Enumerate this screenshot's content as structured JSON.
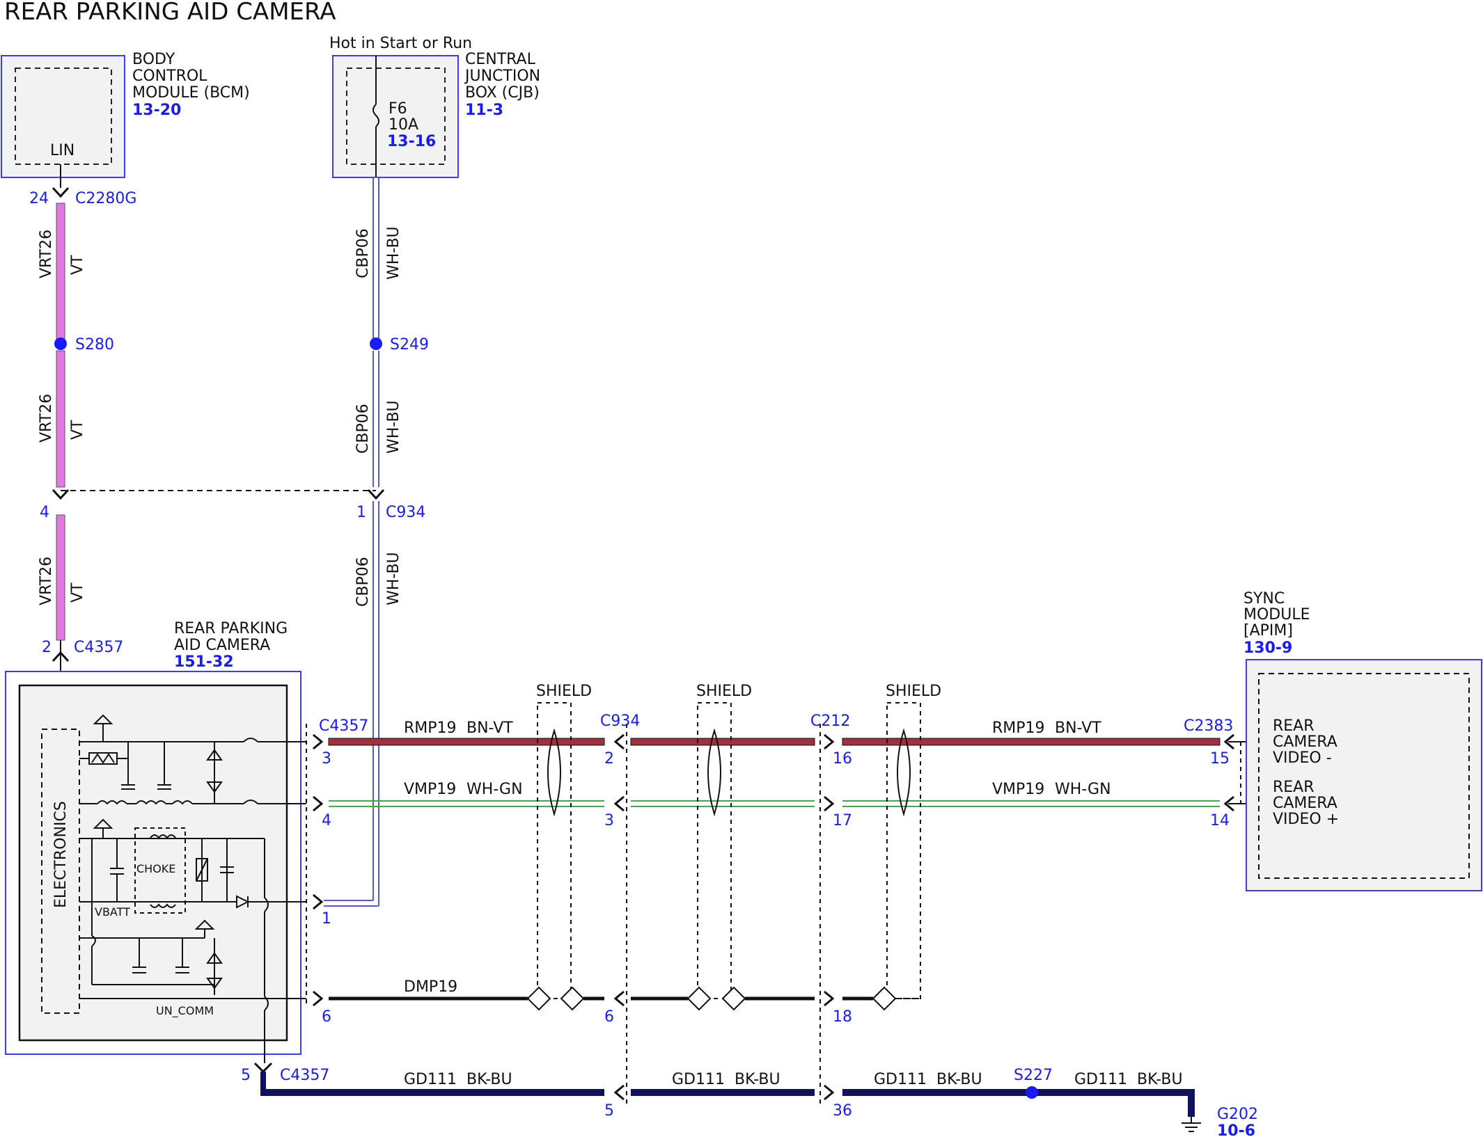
{
  "title": "REAR PARKING AID CAMERA",
  "hot_label": "Hot in Start or Run",
  "bcm": {
    "line1": "BODY",
    "line2": "CONTROL",
    "line3": "MODULE (BCM)",
    "ref": "13-20",
    "pin": "LIN"
  },
  "cjb": {
    "line1": "CENTRAL",
    "line2": "JUNCTION",
    "line3": "BOX (CJB)",
    "ref": "11-3",
    "fuse": "F6",
    "rating": "10A",
    "fuse_ref": "13-16"
  },
  "camera": {
    "line1": "REAR PARKING",
    "line2": "AID CAMERA",
    "ref": "151-32",
    "electronics": "ELECTRONICS",
    "choke": "CHOKE",
    "vbatt": "VBATT",
    "un_comm": "UN_COMM"
  },
  "sync": {
    "line1": "SYNC",
    "line2": "MODULE",
    "line3": "[APIM]",
    "ref": "130-9",
    "pin15_l1": "REAR",
    "pin15_l2": "CAMERA",
    "pin15_l3": "VIDEO -",
    "pin14_l1": "REAR",
    "pin14_l2": "CAMERA",
    "pin14_l3": "VIDEO +"
  },
  "connectors": {
    "c2280g": "C2280G",
    "c2280g_pin": "24",
    "c934_top": "C934",
    "c934_pin1": "1",
    "c934_pin4": "4",
    "c4357_top": "C4357",
    "c4357_pin2": "2",
    "c4357_mid": "C4357",
    "c4357_pin3": "3",
    "c4357_pin4": "4",
    "c4357_pin1": "1",
    "c4357_pin6": "6",
    "c934_mid": "C934",
    "c934_pin2": "2",
    "c934_pin3": "3",
    "c934_pin6": "6",
    "c934_pin5": "5",
    "c212": "C212",
    "c212_pin16": "16",
    "c212_pin17": "17",
    "c212_pin18": "18",
    "c212_pin36": "36",
    "c2383": "C2383",
    "c2383_pin15": "15",
    "c2383_pin14": "14",
    "c4357_bot": "C4357",
    "c4357_pin5": "5"
  },
  "splices": {
    "s280": "S280",
    "s249": "S249",
    "s227": "S227"
  },
  "ground": {
    "name": "G202",
    "ref": "10-6"
  },
  "wires": {
    "vrt26": "VRT26",
    "vt": "VT",
    "cbp06": "CBP06",
    "wh_bu": "WH-BU",
    "rmp19": "RMP19",
    "bn_vt": "BN-VT",
    "vmp19": "VMP19",
    "wh_gn": "WH-GN",
    "dmp19": "DMP19",
    "gd111": "GD111",
    "bk_bu": "BK-BU"
  },
  "shield": "SHIELD",
  "colors": {
    "violet": "#e07ae0",
    "brown_violet": "#a03040",
    "blue_box": "#1a1aff",
    "wh_bu": "#5555ee",
    "wh_gn": "#44aa44",
    "bk_bu": "#101060"
  }
}
